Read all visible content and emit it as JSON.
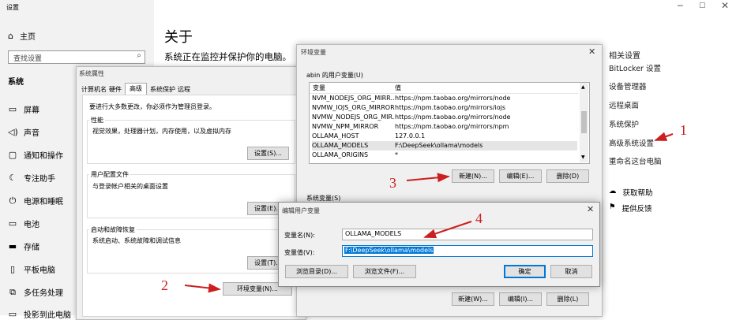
{
  "settings": {
    "title": "设置",
    "home": "主页",
    "search_placeholder": "查找设置",
    "section": "系统",
    "nav": [
      "屏幕",
      "声音",
      "通知和操作",
      "专注助手",
      "电源和睡眠",
      "电池",
      "存储",
      "平板电脑",
      "多任务处理",
      "投影到此电脑"
    ],
    "page_title": "关于",
    "page_subtitle": "系统正在监控并保护你的电脑。",
    "related_header": "相关设置",
    "related_links": [
      "BitLocker 设置",
      "设备管理器",
      "远程桌面",
      "系统保护",
      "高级系统设置",
      "重命名这台电脑"
    ],
    "help": "获取帮助",
    "feedback": "提供反馈"
  },
  "sysprops": {
    "title": "系统属性",
    "tabs": [
      "计算机名",
      "硬件",
      "高级",
      "系统保护",
      "远程"
    ],
    "admin_note": "要进行大多数更改，你必须作为管理员登录。",
    "perf_group": "性能",
    "perf_desc": "视觉效果，处理器计划，内存使用，以及虚拟内存",
    "settings_btn": "设置(S)...",
    "profile_group": "用户配置文件",
    "profile_desc": "与登录帐户相关的桌面设置",
    "profile_btn": "设置(E)...",
    "startup_group": "启动和故障恢复",
    "startup_desc": "系统启动、系统故障和调试信息",
    "startup_btn": "设置(T)...",
    "env_btn": "环境变量(N)..."
  },
  "envvars": {
    "title": "环境变量",
    "user_group": "abin 的用户变量(U)",
    "col_var": "变量",
    "col_val": "值",
    "rows": [
      {
        "name": "NVM_NODEJS_ORG_MIRR...",
        "value": "https://npm.taobao.org/mirrors/node"
      },
      {
        "name": "NVMW_IOJS_ORG_MIRROR",
        "value": "https://npm.taobao.org/mirrors/iojs"
      },
      {
        "name": "NVMW_NODEJS_ORG_MIR...",
        "value": "https://npm.taobao.org/mirrors/node"
      },
      {
        "name": "NVMW_NPM_MIRROR",
        "value": "https://npm.taobao.org/mirrors/npm"
      },
      {
        "name": "OLLAMA_HOST",
        "value": "127.0.0.1"
      },
      {
        "name": "OLLAMA_MODELS",
        "value": "F:\\DeepSeek\\ollama\\models"
      },
      {
        "name": "OLLAMA_ORIGINS",
        "value": "*"
      }
    ],
    "new_btn": "新建(N)...",
    "edit_btn": "编辑(E)...",
    "delete_btn": "删除(D)",
    "system_group": "系统变量(S)",
    "sys_new_btn": "新建(W)...",
    "sys_edit_btn": "编辑(I)...",
    "sys_delete_btn": "删除(L)"
  },
  "editdlg": {
    "title": "编辑用户变量",
    "name_label": "变量名(N):",
    "name_value": "OLLAMA_MODELS",
    "value_label": "变量值(V):",
    "value_value": "F:\\DeepSeek\\ollama\\models",
    "browse_dir": "浏览目录(D)...",
    "browse_file": "浏览文件(F)...",
    "ok": "确定",
    "cancel": "取消"
  },
  "annotations": [
    "1",
    "2",
    "3",
    "4"
  ],
  "colors": {
    "accent": "#0078d7",
    "annotation": "#cc1f1f"
  }
}
